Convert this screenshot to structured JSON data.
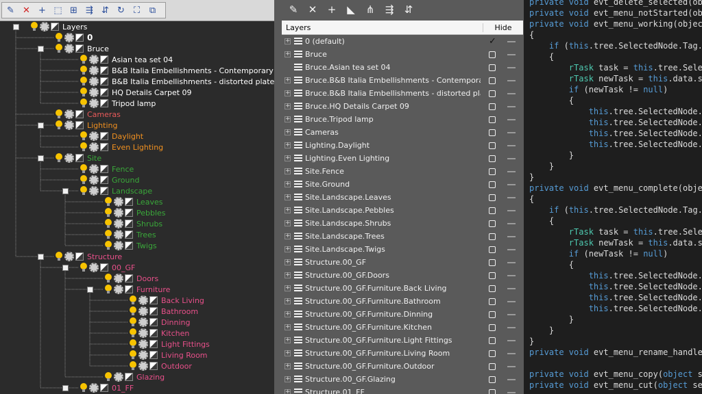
{
  "left_toolbar": {
    "buttons": [
      {
        "name": "add-layer-icon",
        "glyph": "✎"
      },
      {
        "name": "delete-icon",
        "glyph": "✕"
      },
      {
        "name": "plus-icon",
        "glyph": "+"
      },
      {
        "name": "select-icon",
        "glyph": "⬚"
      },
      {
        "name": "select-objects-icon",
        "glyph": "⊞"
      },
      {
        "name": "move-icon",
        "glyph": "⇶"
      },
      {
        "name": "merge-icon",
        "glyph": "⇵"
      },
      {
        "name": "refresh-icon",
        "glyph": "↻"
      },
      {
        "name": "fit-icon",
        "glyph": "⛶"
      },
      {
        "name": "settings-icon",
        "glyph": "⧉"
      }
    ]
  },
  "tree": [
    {
      "label": "Layers",
      "color": "white",
      "level": 0,
      "expander": "−"
    },
    {
      "label": "0",
      "color": "white",
      "level": 1,
      "bold": true
    },
    {
      "label": "Bruce",
      "color": "white",
      "level": 1,
      "expander": "−"
    },
    {
      "label": "Asian tea set 04",
      "color": "white",
      "level": 2
    },
    {
      "label": "B&B Italia Embellishments - Contemporary Jug",
      "color": "white",
      "level": 2
    },
    {
      "label": "B&B Italia Embellishments - distorted plates",
      "color": "white",
      "level": 2
    },
    {
      "label": "HQ Details Carpet 09",
      "color": "white",
      "level": 2
    },
    {
      "label": "Tripod lamp",
      "color": "white",
      "level": 2
    },
    {
      "label": "Cameras",
      "color": "red",
      "level": 1
    },
    {
      "label": "Lighting",
      "color": "orange",
      "level": 1,
      "expander": "−"
    },
    {
      "label": "Daylight",
      "color": "orange",
      "level": 2
    },
    {
      "label": "Even Lighting",
      "color": "orange",
      "level": 2
    },
    {
      "label": "Site",
      "color": "green",
      "level": 1,
      "expander": "−"
    },
    {
      "label": "Fence",
      "color": "green",
      "level": 2
    },
    {
      "label": "Ground",
      "color": "green",
      "level": 2
    },
    {
      "label": "Landscape",
      "color": "green",
      "level": 2,
      "expander": "−"
    },
    {
      "label": "Leaves",
      "color": "green",
      "level": 3
    },
    {
      "label": "Pebbles",
      "color": "green",
      "level": 3
    },
    {
      "label": "Shrubs",
      "color": "green",
      "level": 3
    },
    {
      "label": "Trees",
      "color": "green",
      "level": 3
    },
    {
      "label": "Twigs",
      "color": "green",
      "level": 3
    },
    {
      "label": "Structure",
      "color": "pink",
      "level": 1,
      "expander": "−"
    },
    {
      "label": "00_GF",
      "color": "pink",
      "level": 2,
      "expander": "−"
    },
    {
      "label": "Doors",
      "color": "pink",
      "level": 3
    },
    {
      "label": "Furniture",
      "color": "pink",
      "level": 3,
      "expander": "−"
    },
    {
      "label": "Back Living",
      "color": "pink",
      "level": 4
    },
    {
      "label": "Bathroom",
      "color": "pink",
      "level": 4
    },
    {
      "label": "Dinning",
      "color": "pink",
      "level": 4
    },
    {
      "label": "Kitchen",
      "color": "pink",
      "level": 4
    },
    {
      "label": "Light Fittings",
      "color": "pink",
      "level": 4
    },
    {
      "label": "Living Room",
      "color": "pink",
      "level": 4
    },
    {
      "label": "Outdoor",
      "color": "pink",
      "level": 4
    },
    {
      "label": "Glazing",
      "color": "pink",
      "level": 3
    },
    {
      "label": "01_FF",
      "color": "pink",
      "level": 2,
      "expander": "−"
    }
  ],
  "mid_toolbar": {
    "buttons": [
      {
        "name": "edit-layer-icon",
        "glyph": "✎"
      },
      {
        "name": "close-icon",
        "glyph": "✕"
      },
      {
        "name": "add-icon",
        "glyph": "+"
      },
      {
        "name": "tag-icon",
        "glyph": "◣"
      },
      {
        "name": "filter-icon",
        "glyph": "⋔"
      },
      {
        "name": "sort-icon",
        "glyph": "⇶"
      },
      {
        "name": "group-icon",
        "glyph": "⇵"
      }
    ]
  },
  "list": {
    "header_layers": "Layers",
    "header_hide": "Hide",
    "rows": [
      {
        "name": "0 (default)",
        "plus": true,
        "checked": true
      },
      {
        "name": "Bruce",
        "plus": true
      },
      {
        "name": "Bruce.Asian tea set 04",
        "plus": false
      },
      {
        "name": "Bruce.B&B Italia Embellishments - Contemporary Jug",
        "plus": true
      },
      {
        "name": "Bruce.B&B Italia Embellishments - distorted plates",
        "plus": true
      },
      {
        "name": "Bruce.HQ Details Carpet 09",
        "plus": true
      },
      {
        "name": "Bruce.Tripod lamp",
        "plus": true
      },
      {
        "name": "Cameras",
        "plus": true
      },
      {
        "name": "Lighting.Daylight",
        "plus": true
      },
      {
        "name": "Lighting.Even Lighting",
        "plus": true
      },
      {
        "name": "Site.Fence",
        "plus": true
      },
      {
        "name": "Site.Ground",
        "plus": true
      },
      {
        "name": "Site.Landscape.Leaves",
        "plus": true
      },
      {
        "name": "Site.Landscape.Pebbles",
        "plus": true
      },
      {
        "name": "Site.Landscape.Shrubs",
        "plus": true
      },
      {
        "name": "Site.Landscape.Trees",
        "plus": true
      },
      {
        "name": "Site.Landscape.Twigs",
        "plus": true
      },
      {
        "name": "Structure.00_GF",
        "plus": true
      },
      {
        "name": "Structure.00_GF.Doors",
        "plus": true
      },
      {
        "name": "Structure.00_GF.Furniture.Back Living",
        "plus": true
      },
      {
        "name": "Structure.00_GF.Furniture.Bathroom",
        "plus": true
      },
      {
        "name": "Structure.00_GF.Furniture.Dinning",
        "plus": true
      },
      {
        "name": "Structure.00_GF.Furniture.Kitchen",
        "plus": true
      },
      {
        "name": "Structure.00_GF.Furniture.Light Fittings",
        "plus": true
      },
      {
        "name": "Structure.00_GF.Furniture.Living Room",
        "plus": true
      },
      {
        "name": "Structure.00_GF.Furniture.Outdoor",
        "plus": true
      },
      {
        "name": "Structure.00_GF.Glazing",
        "plus": true
      },
      {
        "name": "Structure.01_FF",
        "plus": true
      }
    ]
  },
  "code": [
    [
      [
        "kw",
        "private "
      ],
      [
        "kw",
        "void "
      ],
      [
        "tx",
        "evt_delete_selected(obj"
      ]
    ],
    [
      [
        "kw",
        "private "
      ],
      [
        "kw",
        "void "
      ],
      [
        "tx",
        "evt_menu_notStarted(obj"
      ]
    ],
    [
      [
        "kw",
        "private "
      ],
      [
        "kw",
        "void "
      ],
      [
        "tx",
        "evt_menu_working(object"
      ]
    ],
    [
      [
        "tx",
        "{"
      ]
    ],
    [
      [
        "tx",
        "    "
      ],
      [
        "kw",
        "if "
      ],
      [
        "tx",
        "("
      ],
      [
        "kw",
        "this"
      ],
      [
        "tx",
        ".tree.SelectedNode.Tag.T"
      ]
    ],
    [
      [
        "tx",
        "    {"
      ]
    ],
    [
      [
        "tx",
        "        "
      ],
      [
        "ty",
        "rTask "
      ],
      [
        "tx",
        "task = "
      ],
      [
        "kw",
        "this"
      ],
      [
        "tx",
        ".tree.Selec"
      ]
    ],
    [
      [
        "tx",
        "        "
      ],
      [
        "ty",
        "rTask "
      ],
      [
        "tx",
        "newTask = "
      ],
      [
        "kw",
        "this"
      ],
      [
        "tx",
        ".data.se"
      ]
    ],
    [
      [
        "tx",
        "        "
      ],
      [
        "kw",
        "if "
      ],
      [
        "tx",
        "(newTask != "
      ],
      [
        "kw",
        "null"
      ],
      [
        "tx",
        ")"
      ]
    ],
    [
      [
        "tx",
        "        {"
      ]
    ],
    [
      [
        "tx",
        "            "
      ],
      [
        "kw",
        "this"
      ],
      [
        "tx",
        ".tree.SelectedNode.I"
      ]
    ],
    [
      [
        "tx",
        "            "
      ],
      [
        "kw",
        "this"
      ],
      [
        "tx",
        ".tree.SelectedNode.S"
      ]
    ],
    [
      [
        "tx",
        "            "
      ],
      [
        "kw",
        "this"
      ],
      [
        "tx",
        ".tree.SelectedNode.T"
      ]
    ],
    [
      [
        "tx",
        "            "
      ],
      [
        "kw",
        "this"
      ],
      [
        "tx",
        ".tree.SelectedNode.T"
      ]
    ],
    [
      [
        "tx",
        "        }"
      ]
    ],
    [
      [
        "tx",
        "    }"
      ]
    ],
    [
      [
        "tx",
        "}"
      ]
    ],
    [
      [
        "kw",
        "private "
      ],
      [
        "kw",
        "void "
      ],
      [
        "tx",
        "evt_menu_complete(objec"
      ]
    ],
    [
      [
        "tx",
        "{"
      ]
    ],
    [
      [
        "tx",
        "    "
      ],
      [
        "kw",
        "if "
      ],
      [
        "tx",
        "("
      ],
      [
        "kw",
        "this"
      ],
      [
        "tx",
        ".tree.SelectedNode.Tag.T"
      ]
    ],
    [
      [
        "tx",
        "    {"
      ]
    ],
    [
      [
        "tx",
        "        "
      ],
      [
        "ty",
        "rTask "
      ],
      [
        "tx",
        "task = "
      ],
      [
        "kw",
        "this"
      ],
      [
        "tx",
        ".tree.Selec"
      ]
    ],
    [
      [
        "tx",
        "        "
      ],
      [
        "ty",
        "rTask "
      ],
      [
        "tx",
        "newTask = "
      ],
      [
        "kw",
        "this"
      ],
      [
        "tx",
        ".data.se"
      ]
    ],
    [
      [
        "tx",
        "        "
      ],
      [
        "kw",
        "if "
      ],
      [
        "tx",
        "(newTask != "
      ],
      [
        "kw",
        "null"
      ],
      [
        "tx",
        ")"
      ]
    ],
    [
      [
        "tx",
        "        {"
      ]
    ],
    [
      [
        "tx",
        "            "
      ],
      [
        "kw",
        "this"
      ],
      [
        "tx",
        ".tree.SelectedNode.I"
      ]
    ],
    [
      [
        "tx",
        "            "
      ],
      [
        "kw",
        "this"
      ],
      [
        "tx",
        ".tree.SelectedNode.S"
      ]
    ],
    [
      [
        "tx",
        "            "
      ],
      [
        "kw",
        "this"
      ],
      [
        "tx",
        ".tree.SelectedNode.T"
      ]
    ],
    [
      [
        "tx",
        "            "
      ],
      [
        "kw",
        "this"
      ],
      [
        "tx",
        ".tree.SelectedNode.T"
      ]
    ],
    [
      [
        "tx",
        "        }"
      ]
    ],
    [
      [
        "tx",
        "    }"
      ]
    ],
    [
      [
        "tx",
        "}"
      ]
    ],
    [
      [
        "kw",
        "private "
      ],
      [
        "kw",
        "void "
      ],
      [
        "tx",
        "evt_menu_rename_handler"
      ]
    ],
    [
      [
        "tx",
        ""
      ]
    ],
    [
      [
        "kw",
        "private "
      ],
      [
        "kw",
        "void "
      ],
      [
        "tx",
        "evt_menu_copy("
      ],
      [
        "kw",
        "object "
      ],
      [
        "tx",
        "se"
      ]
    ],
    [
      [
        "kw",
        "private "
      ],
      [
        "kw",
        "void "
      ],
      [
        "tx",
        "evt_menu_cut("
      ],
      [
        "kw",
        "object "
      ],
      [
        "tx",
        "sen"
      ]
    ]
  ]
}
